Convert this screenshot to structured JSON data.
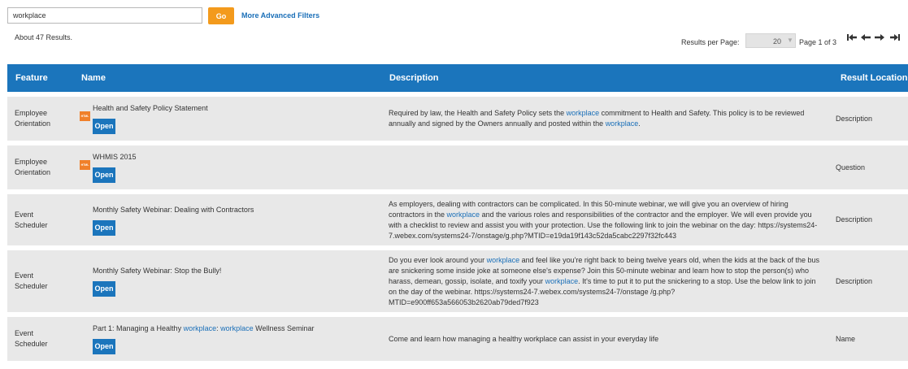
{
  "search": {
    "value": "workplace",
    "go_label": "Go",
    "advanced_label": "More Advanced Filters"
  },
  "results": {
    "count_text": "About 47 Results.",
    "per_page_label": "Results per Page:",
    "per_page_value": "20",
    "page_info": "Page 1 of 3",
    "pager_icons": [
      "first-page-icon",
      "prev-page-icon",
      "next-page-icon",
      "last-page-icon"
    ]
  },
  "table": {
    "headers": {
      "feature": "Feature",
      "name": "Name",
      "description": "Description",
      "location": "Result Location"
    },
    "open_label": "Open",
    "html_icon_text": "HTML",
    "rows": [
      {
        "feature": "Employee Orientation",
        "title": [
          {
            "t": "Health and Safety Policy Statement"
          }
        ],
        "has_icon": true,
        "description": [
          {
            "t": "Required by law, the Health and Safety Policy sets the "
          },
          {
            "t": "workplace",
            "hl": true
          },
          {
            "t": " commitment to Health and Safety. This policy is to be reviewed annually and signed by the Owners annually and posted within the "
          },
          {
            "t": "workplace",
            "hl": true
          },
          {
            "t": "."
          }
        ],
        "location": "Description"
      },
      {
        "feature": "Employee Orientation",
        "title": [
          {
            "t": "WHMIS 2015"
          }
        ],
        "has_icon": true,
        "description": [],
        "location": "Question"
      },
      {
        "feature": "Event Scheduler",
        "title": [
          {
            "t": "Monthly Safety Webinar: Dealing with Contractors"
          }
        ],
        "has_icon": false,
        "description": [
          {
            "t": "As employers, dealing with contractors can be complicated. In this 50-minute webinar, we will give you an overview of hiring contractors in the "
          },
          {
            "t": "workplace",
            "hl": true
          },
          {
            "t": " and the various roles and responsibilities of the contractor and the employer. We will even provide you with a checklist to review and assist you with your protection. Use the following link to join the webinar on the day: https://systems24-7.webex.com/systems24-7/onstage/g.php?MTID=e19da19f143c52da5cabc2297f32fc443"
          }
        ],
        "location": "Description"
      },
      {
        "feature": "Event Scheduler",
        "title": [
          {
            "t": "Monthly Safety Webinar: Stop the Bully!"
          }
        ],
        "has_icon": false,
        "description": [
          {
            "t": "Do you ever look around your "
          },
          {
            "t": "workplace",
            "hl": true
          },
          {
            "t": " and feel like you're right back to being twelve years old, when the kids at the back of the bus are snickering some inside joke at someone else's expense? Join this 50-minute webinar and learn how to stop the person(s) who harass, demean, gossip, isolate, and toxify your "
          },
          {
            "t": "workplace",
            "hl": true
          },
          {
            "t": ". It's time to put it to put the snickering to a stop. Use the below link to join on the day of the webinar. https://systems24-7.webex.com/systems24-7/onstage /g.php?MTID=e900ff653a566053b2620ab79ded7f923"
          }
        ],
        "location": "Description"
      },
      {
        "feature": "Event Scheduler",
        "title": [
          {
            "t": "Part 1: Managing a Healthy "
          },
          {
            "t": "workplace",
            "hl": true
          },
          {
            "t": ": "
          },
          {
            "t": "workplace",
            "hl": true
          },
          {
            "t": " Wellness Seminar"
          }
        ],
        "has_icon": false,
        "description": [
          {
            "t": "Come and learn how managing a healthy workplace can assist in your everyday life"
          }
        ],
        "location": "Name"
      }
    ]
  }
}
